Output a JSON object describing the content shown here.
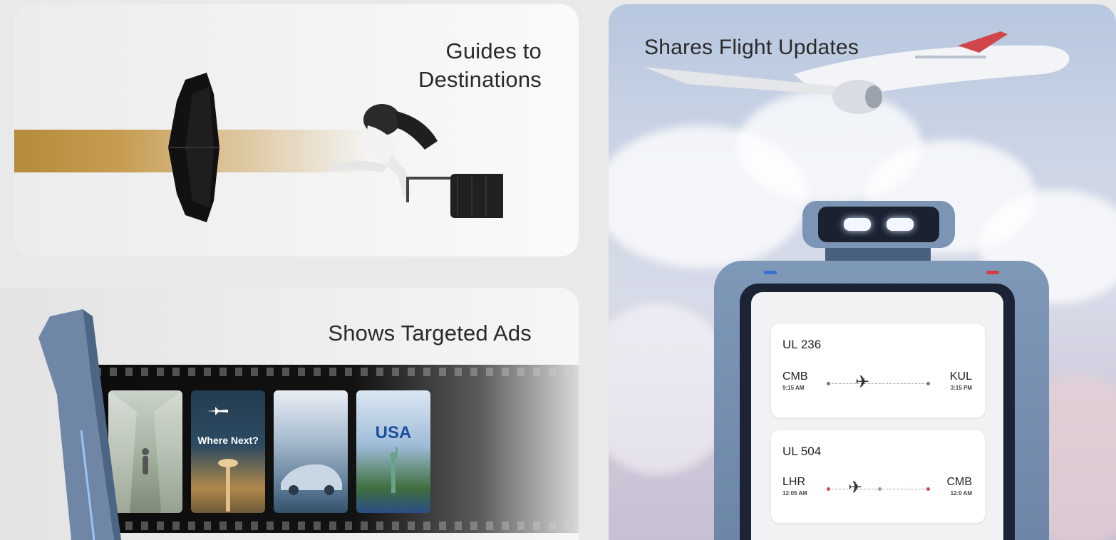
{
  "guides_card": {
    "title_line1": "Guides to",
    "title_line2": "Destinations"
  },
  "ads_card": {
    "title": "Shows Targeted Ads",
    "posters": [
      {
        "text": ""
      },
      {
        "text": "Where Next?"
      },
      {
        "text": ""
      },
      {
        "text": "USA"
      }
    ]
  },
  "flight_card": {
    "title": "Shares Flight Updates",
    "flights": [
      {
        "number": "UL 236",
        "from": "CMB",
        "from_time": "9:15 AM",
        "to": "KUL",
        "to_time": "3:15 PM"
      },
      {
        "number": "UL 504",
        "from": "LHR",
        "from_time": "12:05 AM",
        "to": "CMB",
        "to_time": "12:0 AM"
      }
    ]
  }
}
